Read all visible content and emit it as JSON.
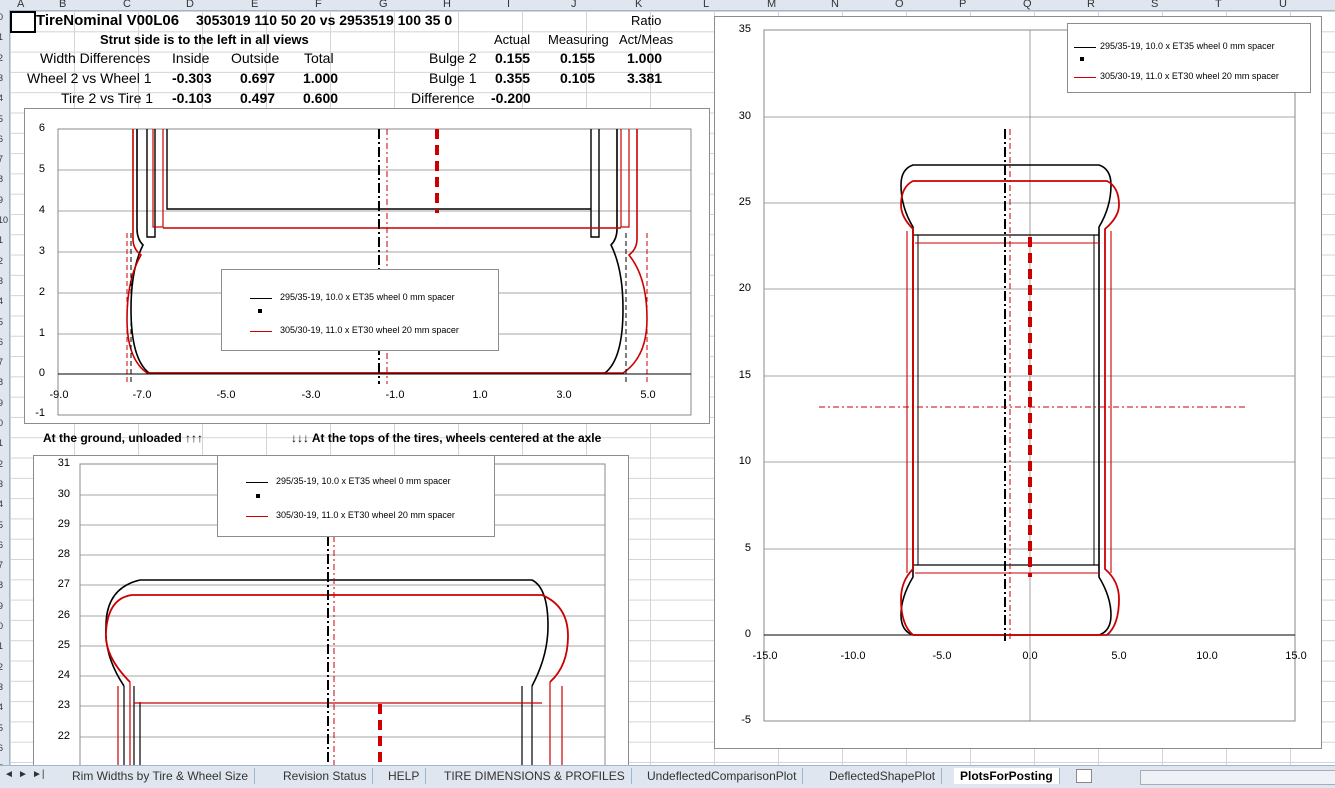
{
  "columns": [
    "A",
    "B",
    "C",
    "D",
    "E",
    "F",
    "G",
    "H",
    "I",
    "J",
    "K",
    "L",
    "M",
    "N",
    "O",
    "P",
    "Q",
    "R",
    "S",
    "T",
    "U"
  ],
  "rows": [
    "0",
    "1",
    "2",
    "3",
    "4",
    "5",
    "6",
    "7",
    "8",
    "9",
    "10",
    "1",
    "2",
    "3",
    "4",
    "5",
    "6",
    "7",
    "8",
    "9",
    "0",
    "1",
    "2",
    "3",
    "4",
    "5",
    "6",
    "7",
    "8",
    "9",
    "0",
    "1",
    "2",
    "3",
    "4",
    "5",
    "6",
    "7"
  ],
  "sheet": {
    "title": "TireNominal V00L06",
    "compare": "3053019 110 50 20 vs  2953519 100 35 0",
    "ratio_label": "Ratio",
    "strut_note": "Strut side is to the left in all views",
    "actual_hdr": "Actual",
    "measuring_hdr": "Measuring",
    "actmeas_hdr": "Act/Meas",
    "width_diff": "Width Differences",
    "inside": "Inside",
    "outside": "Outside",
    "total": "Total",
    "wheel_row": "Wheel 2 vs Wheel 1",
    "wheel_vals": [
      "-0.303",
      "0.697",
      "1.000"
    ],
    "tire_row": "Tire 2 vs Tire 1",
    "tire_vals": [
      "-0.103",
      "0.497",
      "0.600"
    ],
    "bulge2": "Bulge 2",
    "bulge2_vals": [
      "0.155",
      "0.155",
      "1.000"
    ],
    "bulge1": "Bulge 1",
    "bulge1_vals": [
      "0.355",
      "0.105",
      "3.381"
    ],
    "difference": "Difference",
    "difference_val": "-0.200",
    "ground_note": "At the ground, unloaded ↑↑↑",
    "tops_note": "↓↓↓ At the tops of the tires, wheels centered at the axle"
  },
  "legend": {
    "series1": "295/35-19, 10.0 x ET35 wheel 0 mm spacer",
    "series2": "305/30-19, 11.0 x ET30 wheel 20 mm spacer"
  },
  "colors": {
    "series1": "#000000",
    "series2": "#cc0000",
    "grid": "#d4d4d4",
    "header": "#dfe6ef"
  },
  "chart_data": [
    {
      "type": "line",
      "name": "ground-view",
      "xlim": [
        -9,
        6
      ],
      "ylim": [
        -1,
        6
      ],
      "xticks": [
        "-9.0",
        "-7.0",
        "-5.0",
        "-3.0",
        "-1.0",
        "1.0",
        "3.0",
        "5.0"
      ],
      "yticks": [
        "6",
        "5",
        "4",
        "3",
        "2",
        "1",
        "0",
        "-1"
      ]
    },
    {
      "type": "line",
      "name": "top-view",
      "ylim": [
        21,
        31
      ],
      "yticks": [
        "31",
        "30",
        "29",
        "28",
        "27",
        "26",
        "25",
        "24",
        "23",
        "22"
      ]
    },
    {
      "type": "line",
      "name": "side-view",
      "xlim": [
        -15,
        15
      ],
      "ylim": [
        -5,
        35
      ],
      "xticks": [
        "-15.0",
        "-10.0",
        "-5.0",
        "0.0",
        "5.0",
        "10.0",
        "15.0"
      ],
      "yticks": [
        "35",
        "30",
        "25",
        "20",
        "15",
        "10",
        "5",
        "0",
        "-5"
      ]
    }
  ],
  "tabs": [
    "Rim Widths by Tire & Wheel Size",
    "Revision Status",
    "HELP",
    "TIRE DIMENSIONS & PROFILES",
    "UndeflectedComparisonPlot",
    "DeflectedShapePlot",
    "PlotsForPosting"
  ],
  "nav": [
    "◄",
    "►",
    "►|"
  ]
}
